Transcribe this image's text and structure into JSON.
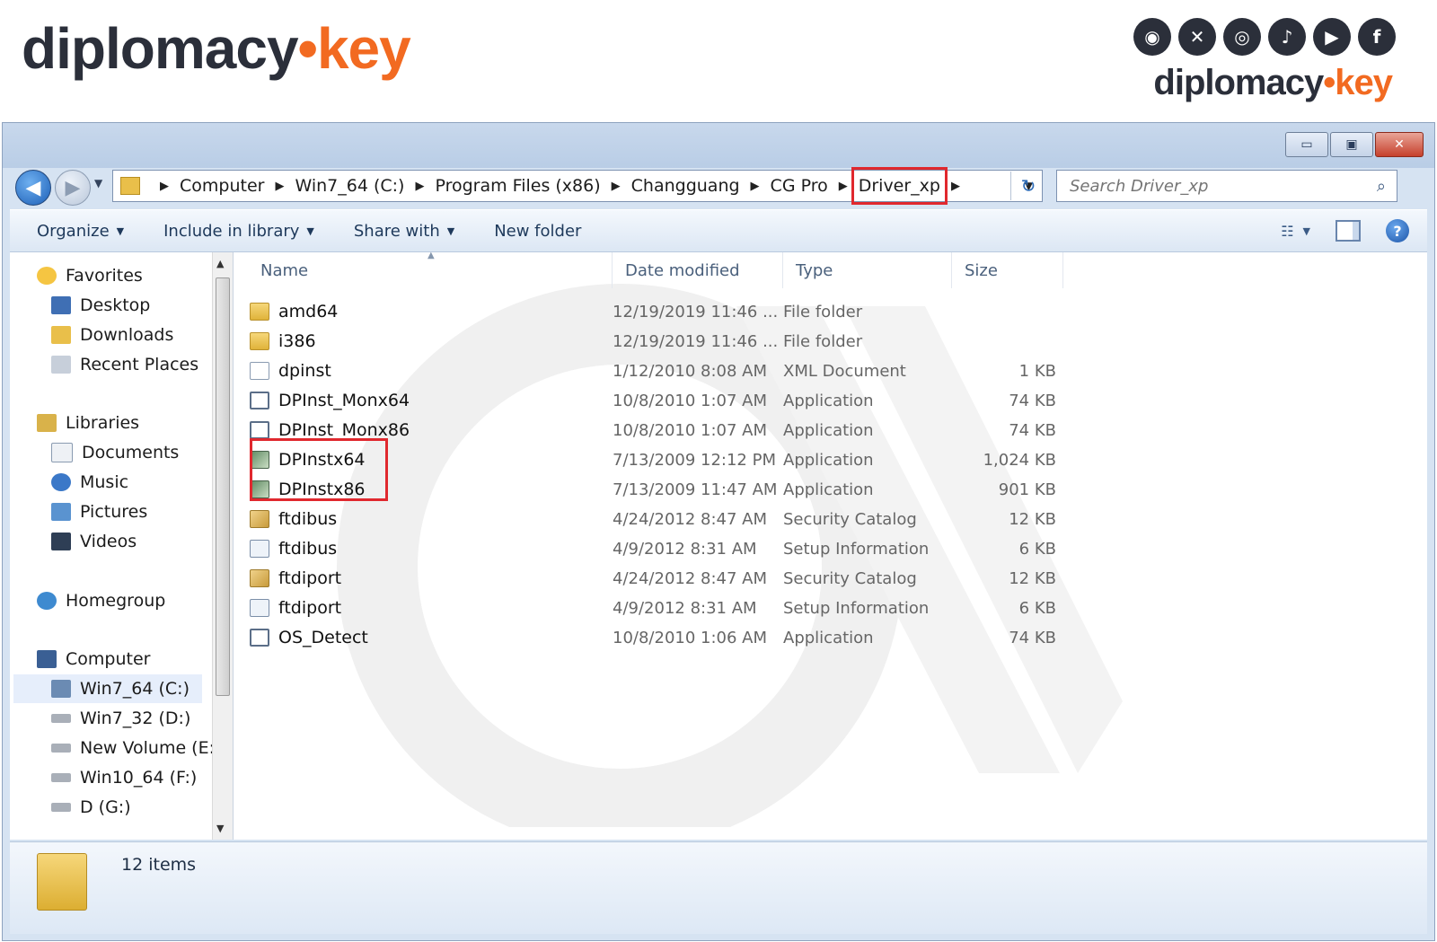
{
  "brand": {
    "word": "diplomacy",
    "dot": "•",
    "suffix": "key"
  },
  "social_icons": [
    "snapchat-icon",
    "x-icon",
    "instagram-icon",
    "tiktok-icon",
    "youtube-icon",
    "facebook-icon"
  ],
  "window": {
    "controls": {
      "minimize": "▭",
      "maximize": "▣",
      "close": "✕"
    },
    "address": {
      "crumbs": [
        "Computer",
        "Win7_64 (C:)",
        "Program Files (x86)",
        "Changguang",
        "CG Pro",
        "Driver_xp"
      ],
      "highlighted_crumb": "Driver_xp"
    },
    "search": {
      "placeholder": "Search Driver_xp"
    }
  },
  "toolbar": {
    "organize": "Organize",
    "include_in_library": "Include in library",
    "share_with": "Share with",
    "new_folder": "New folder"
  },
  "navpane": {
    "favorites": "Favorites",
    "desktop": "Desktop",
    "downloads": "Downloads",
    "recent_places": "Recent Places",
    "libraries": "Libraries",
    "documents": "Documents",
    "music": "Music",
    "pictures": "Pictures",
    "videos": "Videos",
    "homegroup": "Homegroup",
    "computer": "Computer",
    "drive_c": "Win7_64 (C:)",
    "drive_d": "Win7_32 (D:)",
    "drive_e": "New Volume (E:)",
    "drive_f": "Win10_64 (F:)",
    "drive_g": "D (G:)"
  },
  "columns": {
    "name": "Name",
    "date": "Date modified",
    "type": "Type",
    "size": "Size"
  },
  "files": [
    {
      "name": "amd64",
      "date": "12/19/2019 11:46 ...",
      "type": "File folder",
      "size": ""
    },
    {
      "name": "i386",
      "date": "12/19/2019 11:46 ...",
      "type": "File folder",
      "size": ""
    },
    {
      "name": "dpinst",
      "date": "1/12/2010 8:08 AM",
      "type": "XML Document",
      "size": "1 KB"
    },
    {
      "name": "DPInst_Monx64",
      "date": "10/8/2010 1:07 AM",
      "type": "Application",
      "size": "74 KB"
    },
    {
      "name": "DPInst_Monx86",
      "date": "10/8/2010 1:07 AM",
      "type": "Application",
      "size": "74 KB"
    },
    {
      "name": "DPInstx64",
      "date": "7/13/2009 12:12 PM",
      "type": "Application",
      "size": "1,024 KB"
    },
    {
      "name": "DPInstx86",
      "date": "7/13/2009 11:47 AM",
      "type": "Application",
      "size": "901 KB"
    },
    {
      "name": "ftdibus",
      "date": "4/24/2012 8:47 AM",
      "type": "Security Catalog",
      "size": "12 KB"
    },
    {
      "name": "ftdibus",
      "date": "4/9/2012 8:31 AM",
      "type": "Setup Information",
      "size": "6 KB"
    },
    {
      "name": "ftdiport",
      "date": "4/24/2012 8:47 AM",
      "type": "Security Catalog",
      "size": "12 KB"
    },
    {
      "name": "ftdiport",
      "date": "4/9/2012 8:31 AM",
      "type": "Setup Information",
      "size": "6 KB"
    },
    {
      "name": "OS_Detect",
      "date": "10/8/2010 1:06 AM",
      "type": "Application",
      "size": "74 KB"
    }
  ],
  "status": {
    "item_count": "12 items"
  },
  "colors": {
    "brand_dark": "#2b2f3a",
    "brand_orange": "#f26a21",
    "highlight_red": "#e0282e"
  }
}
